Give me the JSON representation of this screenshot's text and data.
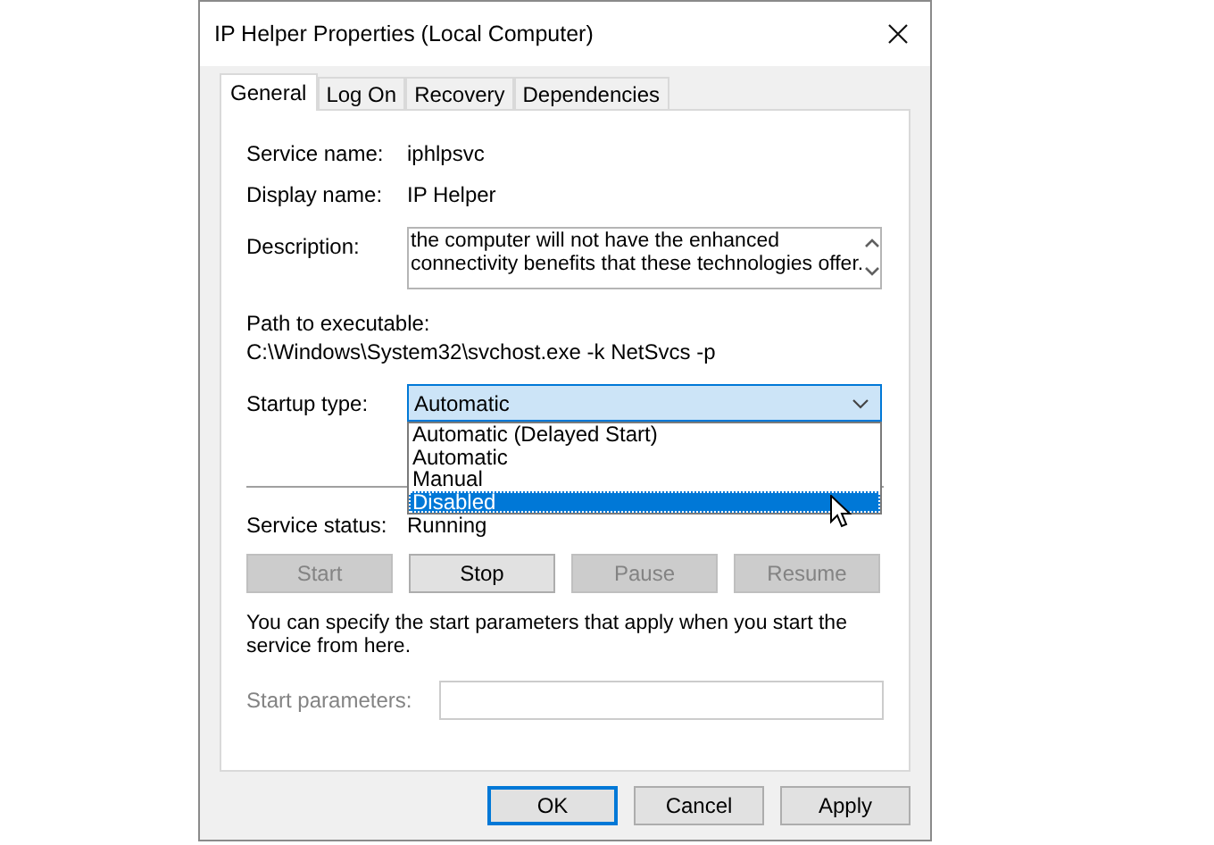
{
  "window": {
    "title": "IP Helper Properties (Local Computer)"
  },
  "tabs": [
    {
      "label": "General",
      "selected": true
    },
    {
      "label": "Log On",
      "selected": false
    },
    {
      "label": "Recovery",
      "selected": false
    },
    {
      "label": "Dependencies",
      "selected": false
    }
  ],
  "service_name": {
    "label": "Service name:",
    "value": "iphlpsvc"
  },
  "display_name": {
    "label": "Display name:",
    "value": "IP Helper"
  },
  "description": {
    "label": "Description:",
    "lines": [
      "the computer will not have the enhanced",
      "connectivity benefits that these technologies offer."
    ]
  },
  "path": {
    "label": "Path to executable:",
    "value": "C:\\Windows\\System32\\svchost.exe -k NetSvcs -p"
  },
  "startup_type": {
    "label": "Startup type:",
    "value": "Automatic",
    "expanded": true,
    "options": [
      {
        "label": "Automatic (Delayed Start)",
        "highlighted": false
      },
      {
        "label": "Automatic",
        "highlighted": false
      },
      {
        "label": "Manual",
        "highlighted": false
      },
      {
        "label": "Disabled",
        "highlighted": true
      }
    ]
  },
  "service_status": {
    "label": "Service status:",
    "value": "Running"
  },
  "service_buttons": [
    {
      "label": "Start",
      "disabled": true
    },
    {
      "label": "Stop",
      "disabled": false
    },
    {
      "label": "Pause",
      "disabled": true
    },
    {
      "label": "Resume",
      "disabled": true
    }
  ],
  "hint": "You can specify the start parameters that apply when you start the service from here.",
  "start_parameters": {
    "label": "Start parameters:",
    "disabled": true
  },
  "buttons": [
    {
      "label": "OK",
      "default": true
    },
    {
      "label": "Cancel",
      "default": false
    },
    {
      "label": "Apply",
      "default": false
    }
  ]
}
